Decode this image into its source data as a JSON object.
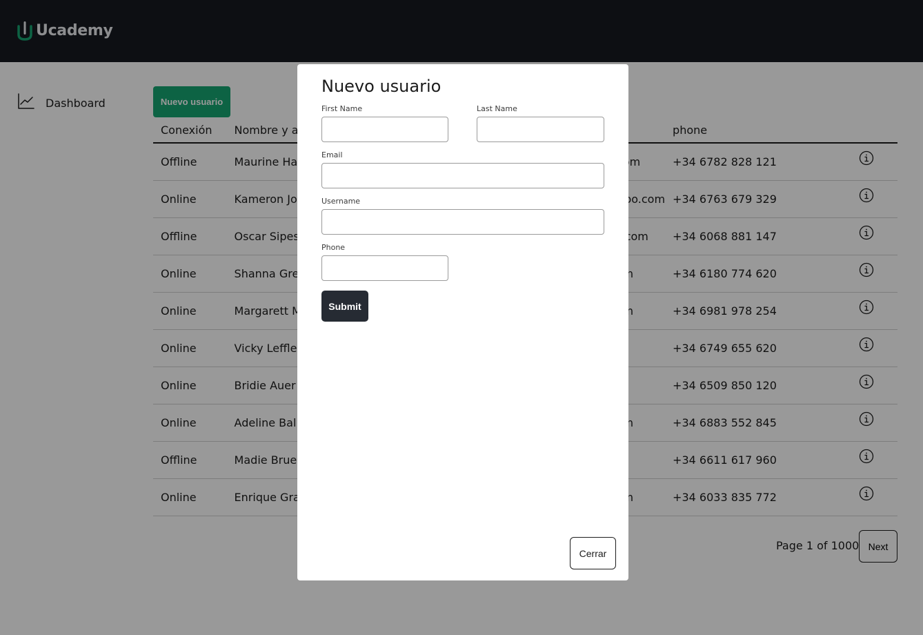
{
  "header": {
    "brand": "Ucademy"
  },
  "sidebar": {
    "items": [
      {
        "label": "Dashboard",
        "icon": "line-chart-icon"
      }
    ]
  },
  "main": {
    "new_user_button": "Nuevo usuario",
    "columns": [
      "Conexión",
      "Nombre y a",
      "",
      "phone",
      ""
    ],
    "rows": [
      {
        "status": "Offline",
        "name": "Maurine Ha",
        "email": "nail.com",
        "phone": "+34 6782 828 121"
      },
      {
        "status": "Online",
        "name": "Kameron Jo",
        "email": "@yahoo.com",
        "phone": "+34 6763 679 329"
      },
      {
        "status": "Offline",
        "name": "Oscar Sipes",
        "email": "tmail.com",
        "phone": "+34 6068 881 147"
      },
      {
        "status": "Online",
        "name": "Shanna Gre",
        "email": "ail.com",
        "phone": "+34 6180 774 620"
      },
      {
        "status": "Online",
        "name": "Margarett M",
        "email": "ail.com",
        "phone": "+34 6981 978 254"
      },
      {
        "status": "Online",
        "name": "Vicky Leffler",
        "email": "il.com",
        "phone": "+34 6749 655 620"
      },
      {
        "status": "Online",
        "name": "Bridie Auer",
        "email": "il.com",
        "phone": "+34 6509 850 120"
      },
      {
        "status": "Online",
        "name": "Adeline Bal",
        "email": "ail.com",
        "phone": "+34 6883 552 845"
      },
      {
        "status": "Offline",
        "name": "Madie Brue",
        "email": "o.com",
        "phone": "+34 6611 617 960"
      },
      {
        "status": "Online",
        "name": "Enrique Gra",
        "email": "ail.com",
        "phone": "+34 6033 835 772"
      }
    ],
    "pagination": {
      "text": "Page 1 of 1000",
      "next_label": "Next"
    }
  },
  "modal": {
    "title": "Nuevo usuario",
    "fields": {
      "first_name": {
        "label": "First Name",
        "value": ""
      },
      "last_name": {
        "label": "Last Name",
        "value": ""
      },
      "email": {
        "label": "Email",
        "value": ""
      },
      "username": {
        "label": "Username",
        "value": ""
      },
      "phone": {
        "label": "Phone",
        "value": ""
      }
    },
    "submit_label": "Submit",
    "close_label": "Cerrar"
  },
  "colors": {
    "header_bg": "#161a20",
    "brand_green": "#17a572",
    "submit_bg": "#262b33"
  }
}
